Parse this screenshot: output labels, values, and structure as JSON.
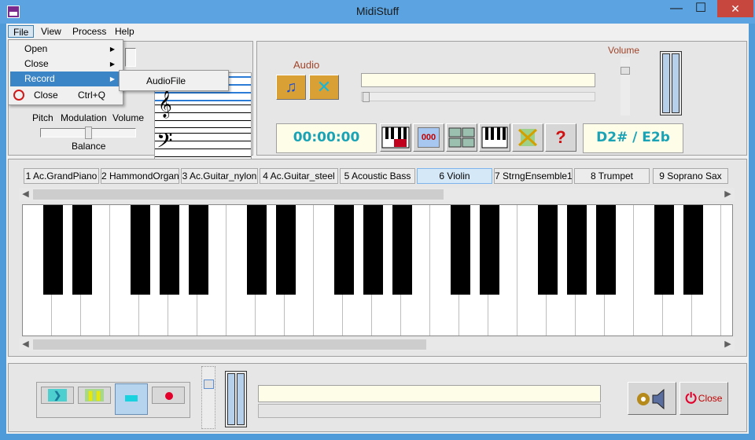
{
  "window": {
    "title": "MidiStuff",
    "minimize": "—",
    "maximize": "☐",
    "close": "✕"
  },
  "menubar": {
    "file": "File",
    "view": "View",
    "process": "Process",
    "help": "Help"
  },
  "file_menu": {
    "items": [
      {
        "label": "Open",
        "arrow": "▶"
      },
      {
        "label": "Close",
        "arrow": "▶"
      },
      {
        "label": "Record",
        "arrow": "▶"
      },
      {
        "label": "Close",
        "shortcut": "Ctrl+Q"
      }
    ],
    "submenu": {
      "items": [
        "AudioFile"
      ]
    }
  },
  "left_panel": {
    "pitch": "Pitch",
    "modulation": "Modulation",
    "volume": "Volume",
    "balance": "Balance"
  },
  "audio_panel": {
    "audio": "Audio",
    "volume": "Volume",
    "time": "00:00:00",
    "counter": "000",
    "note": "D2# / E2b",
    "help": "?"
  },
  "instruments": [
    {
      "label": "1 Ac.GrandPiano",
      "selected": false
    },
    {
      "label": "2 HammondOrgan",
      "selected": false
    },
    {
      "label": "3 Ac.Guitar_nylon",
      "selected": false
    },
    {
      "label": "4 Ac.Guitar_steel",
      "selected": false
    },
    {
      "label": "5 Acoustic Bass",
      "selected": false
    },
    {
      "label": "6 Violin",
      "selected": true
    },
    {
      "label": "7 StrngEnsemble1",
      "selected": false
    },
    {
      "label": "8 Trumpet",
      "selected": false
    },
    {
      "label": "9 Soprano Sax",
      "selected": false
    }
  ],
  "bottom": {
    "close": "Close"
  },
  "colors": {
    "lcd_text": "#1aa3b5",
    "selection": "#3b84c5",
    "record": "#e3002b",
    "play": "#18d2e0",
    "pause": "#e8e800"
  }
}
